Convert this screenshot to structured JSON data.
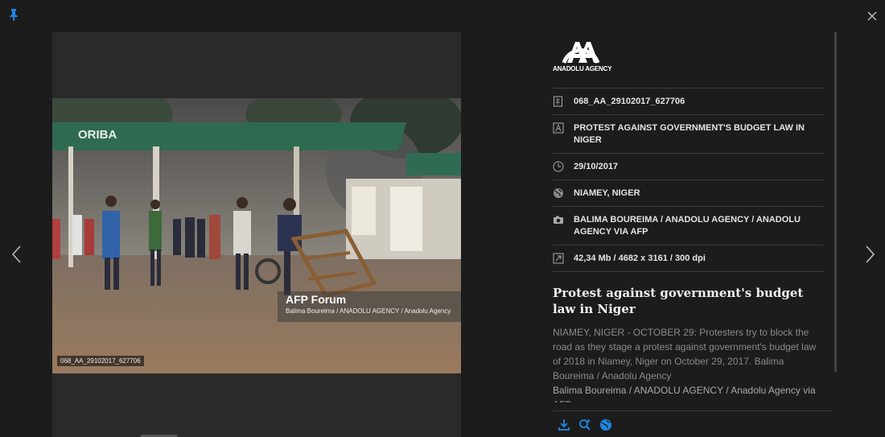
{
  "meta": {
    "agency_logo_text": "ANADOLU AGENCY",
    "rows": [
      {
        "icon": "document-number-icon",
        "text": "068_AA_29102017_627706"
      },
      {
        "icon": "title-icon",
        "text": "PROTEST AGAINST GOVERNMENT'S BUDGET LAW IN NIGER"
      },
      {
        "icon": "clock-icon",
        "text": "29/10/2017"
      },
      {
        "icon": "globe-icon",
        "text": "NIAMEY, NIGER"
      },
      {
        "icon": "camera-icon",
        "text": "BALIMA BOUREIMA / ANADOLU AGENCY / ANADOLU AGENCY VIA AFP"
      },
      {
        "icon": "resize-icon",
        "text": "42,34 Mb / 4682 x 3161 / 300 dpi"
      }
    ],
    "headline": "Protest against government's budget law in Niger",
    "caption": "NIAMEY, NIGER - OCTOBER 29: Protesters try to block the road as they stage a protest against government's budget law of 2018 in Niamey, Niger on October 29, 2017. Balima Boureima / Anadolu Agency",
    "caption_credit": "Balima Boureima / ANADOLU AGENCY / Anadolu Agency via AFP"
  },
  "photo": {
    "watermark_title": "AFP Forum",
    "watermark_credit": "Balima Boureima / ANADOLU AGENCY / Anadolu Agency",
    "id_label": "068_AA_29102017_627706",
    "station_sign": "ORIBA"
  },
  "colors": {
    "accent": "#1e88e5",
    "background": "#1c1c1c"
  }
}
